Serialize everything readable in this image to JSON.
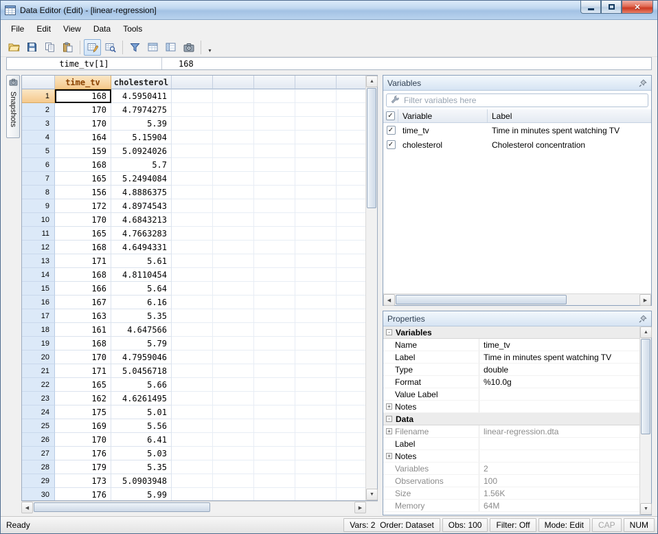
{
  "window": {
    "title": "Data Editor (Edit) - [linear-regression]"
  },
  "menu": [
    "File",
    "Edit",
    "View",
    "Data",
    "Tools"
  ],
  "toolbar": {
    "groups": [
      [
        "open",
        "save",
        "copy",
        "paste"
      ],
      [
        "edit-mode",
        "browse-mode"
      ],
      [
        "filter",
        "variables-window",
        "properties-window",
        "snapshots"
      ]
    ],
    "active": "edit-mode"
  },
  "formula": {
    "ref": "time_tv[1]",
    "value": "168"
  },
  "snapshots": {
    "label": "Snapshots"
  },
  "grid": {
    "columns": [
      "time_tv",
      "cholesterol"
    ],
    "rows": [
      [
        "1",
        "168",
        "4.5950411"
      ],
      [
        "2",
        "170",
        "4.7974275"
      ],
      [
        "3",
        "170",
        "5.39"
      ],
      [
        "4",
        "164",
        "5.15904"
      ],
      [
        "5",
        "159",
        "5.0924026"
      ],
      [
        "6",
        "168",
        "5.7"
      ],
      [
        "7",
        "165",
        "5.2494084"
      ],
      [
        "8",
        "156",
        "4.8886375"
      ],
      [
        "9",
        "172",
        "4.8974543"
      ],
      [
        "10",
        "170",
        "4.6843213"
      ],
      [
        "11",
        "165",
        "4.7663283"
      ],
      [
        "12",
        "168",
        "4.6494331"
      ],
      [
        "13",
        "171",
        "5.61"
      ],
      [
        "14",
        "168",
        "4.8110454"
      ],
      [
        "15",
        "166",
        "5.64"
      ],
      [
        "16",
        "167",
        "6.16"
      ],
      [
        "17",
        "163",
        "5.35"
      ],
      [
        "18",
        "161",
        "4.647566"
      ],
      [
        "19",
        "168",
        "5.79"
      ],
      [
        "20",
        "170",
        "4.7959046"
      ],
      [
        "21",
        "171",
        "5.0456718"
      ],
      [
        "22",
        "165",
        "5.66"
      ],
      [
        "23",
        "162",
        "4.6261495"
      ],
      [
        "24",
        "175",
        "5.01"
      ],
      [
        "25",
        "169",
        "5.56"
      ],
      [
        "26",
        "170",
        "6.41"
      ],
      [
        "27",
        "176",
        "5.03"
      ],
      [
        "28",
        "179",
        "5.35"
      ],
      [
        "29",
        "173",
        "5.0903948"
      ],
      [
        "30",
        "176",
        "5.99"
      ]
    ]
  },
  "variables": {
    "title": "Variables",
    "filter_placeholder": "Filter variables here",
    "headers": [
      "Variable",
      "Label"
    ],
    "rows": [
      {
        "name": "time_tv",
        "label": "Time in minutes spent watching TV",
        "checked": true
      },
      {
        "name": "cholesterol",
        "label": "Cholesterol concentration",
        "checked": true
      }
    ]
  },
  "properties": {
    "title": "Properties",
    "sections": [
      {
        "label": "Variables",
        "expander": "-",
        "rows": [
          {
            "label": "Name",
            "value": "time_tv"
          },
          {
            "label": "Label",
            "value": "Time in minutes spent watching TV"
          },
          {
            "label": "Type",
            "value": "double"
          },
          {
            "label": "Format",
            "value": "%10.0g"
          },
          {
            "label": "Value Label",
            "value": ""
          },
          {
            "label": "Notes",
            "value": "",
            "expander": "+"
          }
        ]
      },
      {
        "label": "Data",
        "expander": "-",
        "rows": [
          {
            "label": "Filename",
            "value": "linear-regression.dta",
            "expander": "+",
            "muted": true
          },
          {
            "label": "Label",
            "value": ""
          },
          {
            "label": "Notes",
            "value": "",
            "expander": "+"
          },
          {
            "label": "Variables",
            "value": "2",
            "muted": true
          },
          {
            "label": "Observations",
            "value": "100",
            "muted": true
          },
          {
            "label": "Size",
            "value": "1.56K",
            "muted": true
          },
          {
            "label": "Memory",
            "value": "64M",
            "muted": true
          }
        ]
      }
    ]
  },
  "status": {
    "ready": "Ready",
    "segments": [
      {
        "name": "vars-order",
        "label": "Vars: 2  Order: Dataset"
      },
      {
        "name": "obs",
        "label": "Obs: 100"
      },
      {
        "name": "filter",
        "label": "Filter: Off"
      },
      {
        "name": "mode",
        "label": "Mode: Edit"
      },
      {
        "name": "cap",
        "label": "CAP",
        "muted": true
      },
      {
        "name": "num",
        "label": "NUM"
      }
    ]
  },
  "icons": {
    "check": "✓",
    "close": "✕",
    "up": "▲",
    "down": "▼",
    "left": "◀",
    "right": "▶",
    "overflow": "▾"
  }
}
